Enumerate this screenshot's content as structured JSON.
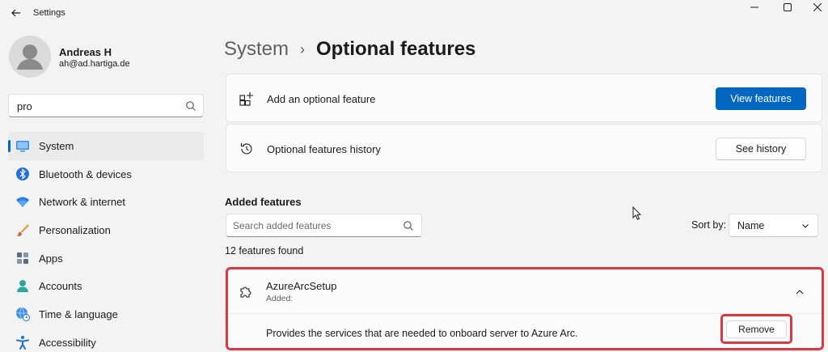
{
  "window": {
    "title": "Settings"
  },
  "profile": {
    "name": "Andreas H",
    "email": "ah@ad.hartiga.de"
  },
  "search": {
    "value": "pro"
  },
  "sidebar": {
    "items": [
      {
        "label": "System",
        "icon": "system-icon",
        "active": true
      },
      {
        "label": "Bluetooth & devices",
        "icon": "bluetooth-icon"
      },
      {
        "label": "Network & internet",
        "icon": "wifi-icon"
      },
      {
        "label": "Personalization",
        "icon": "brush-icon"
      },
      {
        "label": "Apps",
        "icon": "apps-icon"
      },
      {
        "label": "Accounts",
        "icon": "person-icon"
      },
      {
        "label": "Time & language",
        "icon": "globe-clock-icon"
      },
      {
        "label": "Accessibility",
        "icon": "accessibility-icon"
      }
    ]
  },
  "breadcrumb": {
    "parent": "System",
    "separator": "›",
    "current": "Optional features"
  },
  "cards": {
    "add": {
      "label": "Add an optional feature",
      "button": "View features",
      "icon": "grid-plus-icon"
    },
    "history": {
      "label": "Optional features history",
      "button": "See history",
      "icon": "history-icon"
    }
  },
  "added": {
    "title": "Added features",
    "search_placeholder": "Search added features",
    "sort_label": "Sort by:",
    "sort_value": "Name",
    "count": "12 features found",
    "features": [
      {
        "name": "AzureArcSetup",
        "sub": "Added:",
        "description": "Provides the services that are needed to onboard server to Azure Arc.",
        "button": "Remove",
        "icon": "puzzle-icon"
      }
    ]
  },
  "colors": {
    "accent": "#0067c0",
    "highlight": "#d63a42",
    "background": "#f3f3f3"
  }
}
